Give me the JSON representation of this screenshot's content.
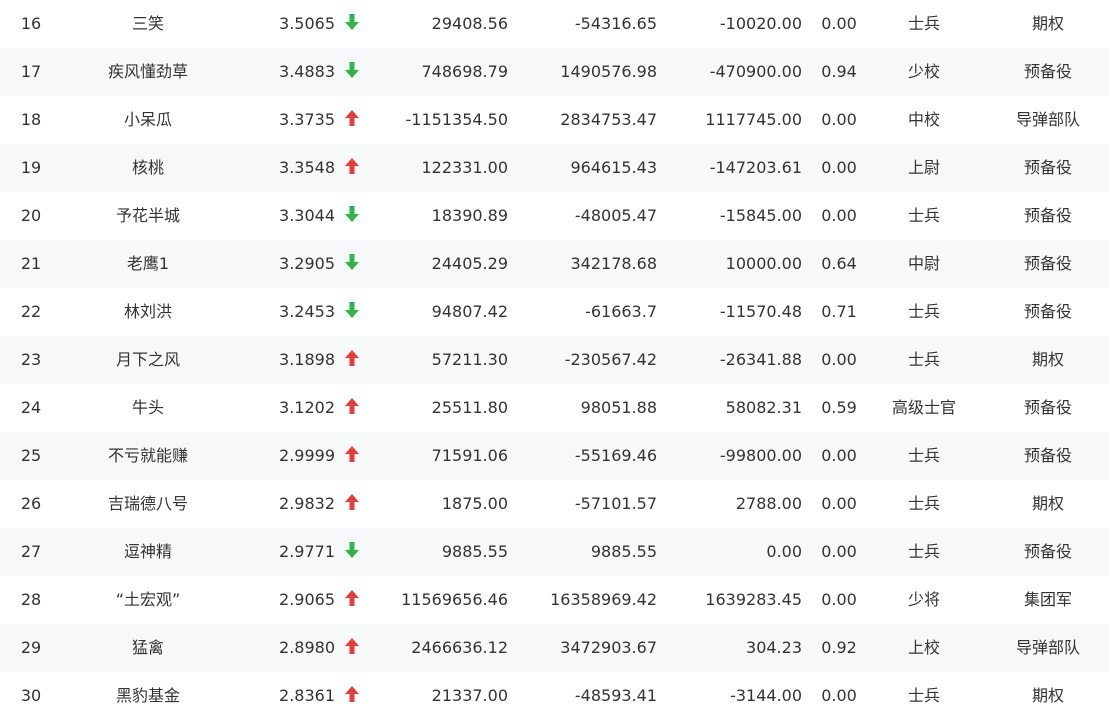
{
  "colors": {
    "up": "#e63e3e",
    "down": "#2fb64a",
    "text": "#333333",
    "row_alt": "#f7f8fa"
  },
  "rows": [
    {
      "rank": "16",
      "name": "三笑",
      "score": "3.5065",
      "trend": "down",
      "v1": "29408.56",
      "v2": "-54316.65",
      "v3": "-10020.00",
      "ratio": "0.00",
      "level": "士兵",
      "type": "期权"
    },
    {
      "rank": "17",
      "name": "疾风懂劲草",
      "score": "3.4883",
      "trend": "down",
      "v1": "748698.79",
      "v2": "1490576.98",
      "v3": "-470900.00",
      "ratio": "0.94",
      "level": "少校",
      "type": "预备役"
    },
    {
      "rank": "18",
      "name": "小呆瓜",
      "score": "3.3735",
      "trend": "up",
      "v1": "-1151354.50",
      "v2": "2834753.47",
      "v3": "1117745.00",
      "ratio": "0.00",
      "level": "中校",
      "type": "导弹部队"
    },
    {
      "rank": "19",
      "name": "核桃",
      "score": "3.3548",
      "trend": "up",
      "v1": "122331.00",
      "v2": "964615.43",
      "v3": "-147203.61",
      "ratio": "0.00",
      "level": "上尉",
      "type": "预备役"
    },
    {
      "rank": "20",
      "name": "予花半城",
      "score": "3.3044",
      "trend": "down",
      "v1": "18390.89",
      "v2": "-48005.47",
      "v3": "-15845.00",
      "ratio": "0.00",
      "level": "士兵",
      "type": "预备役"
    },
    {
      "rank": "21",
      "name": "老鹰1",
      "score": "3.2905",
      "trend": "down",
      "v1": "24405.29",
      "v2": "342178.68",
      "v3": "10000.00",
      "ratio": "0.64",
      "level": "中尉",
      "type": "预备役"
    },
    {
      "rank": "22",
      "name": "林刘洪",
      "score": "3.2453",
      "trend": "down",
      "v1": "94807.42",
      "v2": "-61663.7",
      "v3": "-11570.48",
      "ratio": "0.71",
      "level": "士兵",
      "type": "预备役"
    },
    {
      "rank": "23",
      "name": "月下之风",
      "score": "3.1898",
      "trend": "up",
      "v1": "57211.30",
      "v2": "-230567.42",
      "v3": "-26341.88",
      "ratio": "0.00",
      "level": "士兵",
      "type": "期权"
    },
    {
      "rank": "24",
      "name": "牛头",
      "score": "3.1202",
      "trend": "up",
      "v1": "25511.80",
      "v2": "98051.88",
      "v3": "58082.31",
      "ratio": "0.59",
      "level": "高级士官",
      "type": "预备役"
    },
    {
      "rank": "25",
      "name": "不亏就能赚",
      "score": "2.9999",
      "trend": "up",
      "v1": "71591.06",
      "v2": "-55169.46",
      "v3": "-99800.00",
      "ratio": "0.00",
      "level": "士兵",
      "type": "预备役"
    },
    {
      "rank": "26",
      "name": "吉瑞德八号",
      "score": "2.9832",
      "trend": "up",
      "v1": "1875.00",
      "v2": "-57101.57",
      "v3": "2788.00",
      "ratio": "0.00",
      "level": "士兵",
      "type": "期权"
    },
    {
      "rank": "27",
      "name": "逗神精",
      "score": "2.9771",
      "trend": "down",
      "v1": "9885.55",
      "v2": "9885.55",
      "v3": "0.00",
      "ratio": "0.00",
      "level": "士兵",
      "type": "预备役"
    },
    {
      "rank": "28",
      "name": "“土宏观”",
      "score": "2.9065",
      "trend": "up",
      "v1": "11569656.46",
      "v2": "16358969.42",
      "v3": "1639283.45",
      "ratio": "0.00",
      "level": "少将",
      "type": "集团军"
    },
    {
      "rank": "29",
      "name": "猛禽",
      "score": "2.8980",
      "trend": "up",
      "v1": "2466636.12",
      "v2": "3472903.67",
      "v3": "304.23",
      "ratio": "0.92",
      "level": "上校",
      "type": "导弹部队"
    },
    {
      "rank": "30",
      "name": "黑豹基金",
      "score": "2.8361",
      "trend": "up",
      "v1": "21337.00",
      "v2": "-48593.41",
      "v3": "-3144.00",
      "ratio": "0.00",
      "level": "士兵",
      "type": "期权"
    }
  ]
}
